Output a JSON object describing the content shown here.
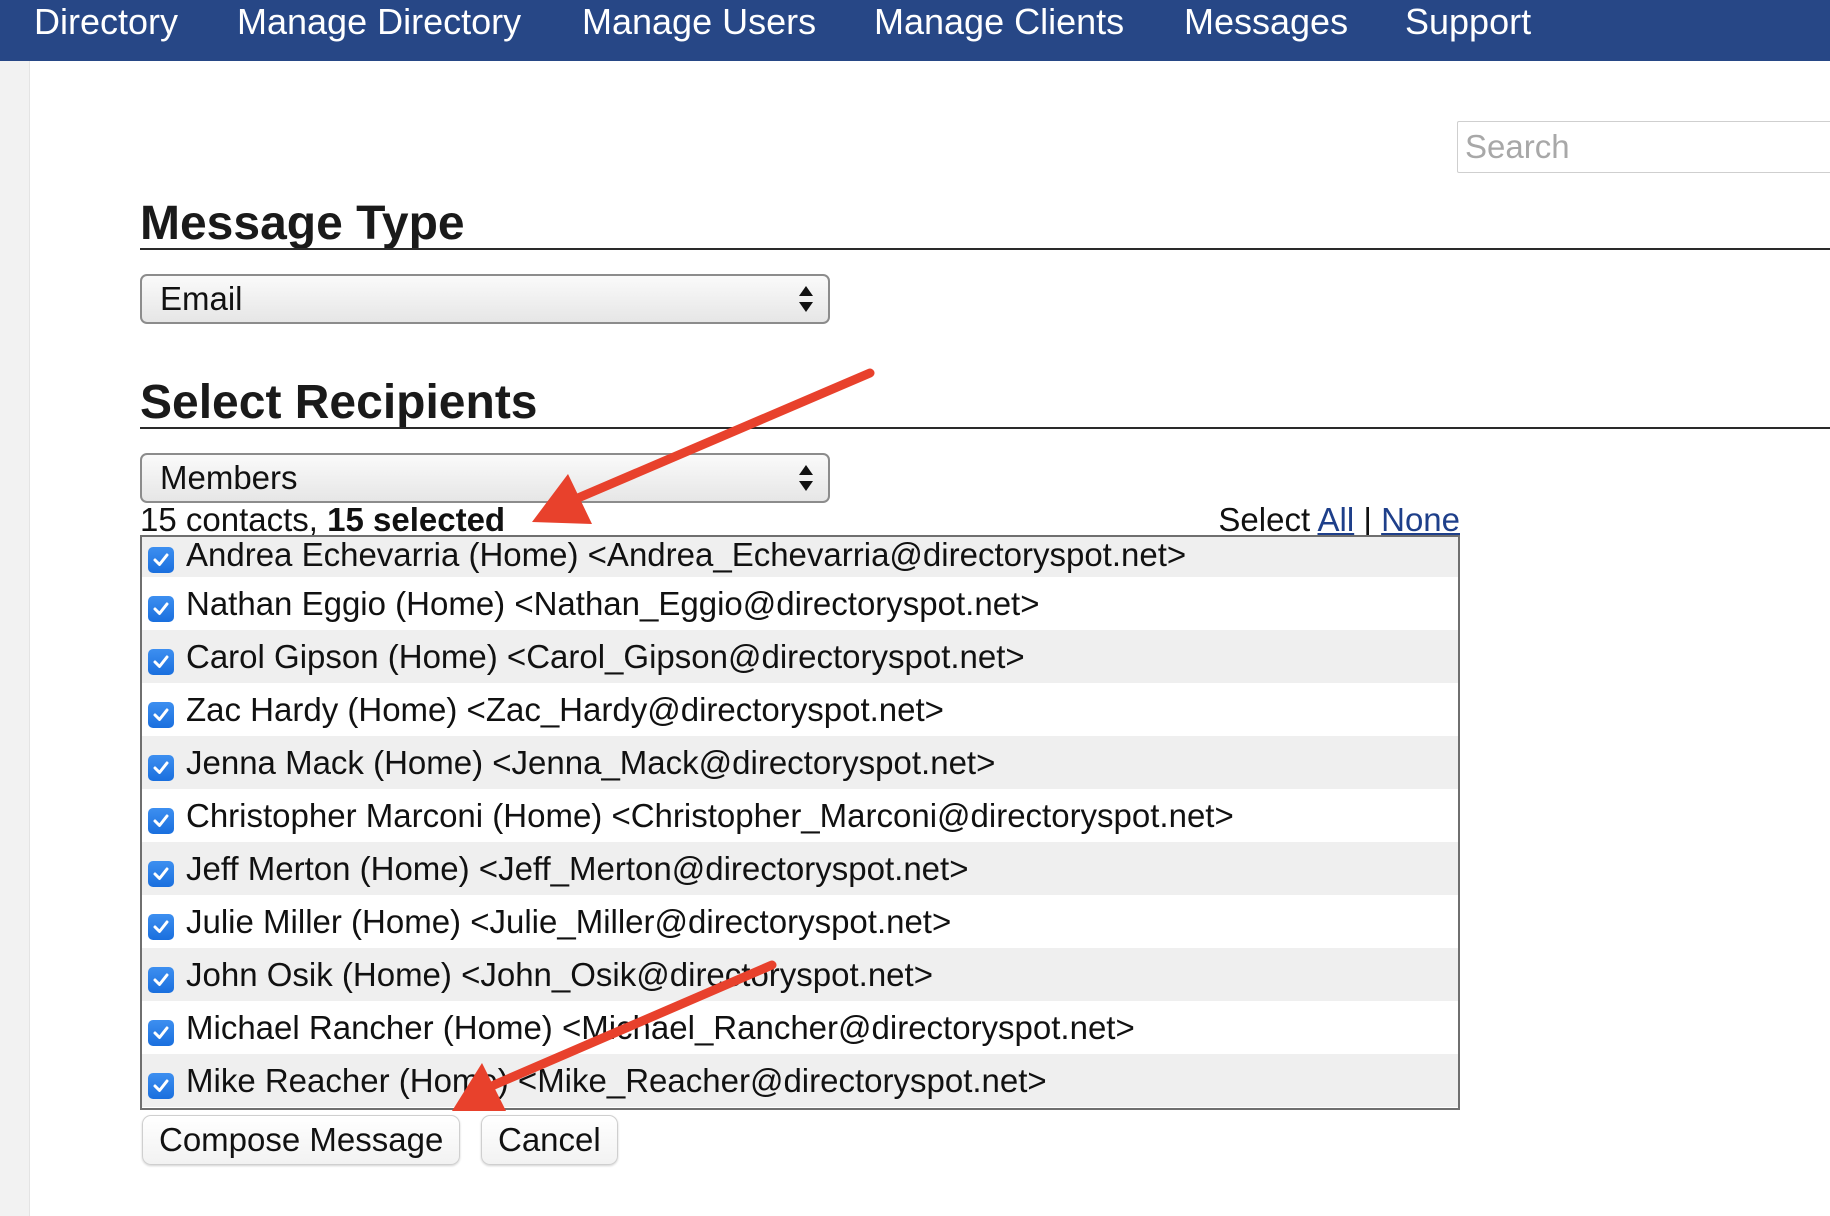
{
  "nav": {
    "items": [
      {
        "label": "Directory"
      },
      {
        "label": "Manage Directory"
      },
      {
        "label": "Manage Users"
      },
      {
        "label": "Manage Clients"
      },
      {
        "label": "Messages"
      },
      {
        "label": "Support"
      }
    ],
    "bg_color": "#274786"
  },
  "search": {
    "placeholder": "Search"
  },
  "message_type": {
    "heading": "Message Type",
    "selected": "Email"
  },
  "recipients": {
    "heading": "Select Recipients",
    "group_selected": "Members",
    "contacts_count_text": "15 contacts,",
    "selected_count_text": "15 selected",
    "select_label": "Select",
    "select_all": "All",
    "separator": "|",
    "select_none": "None",
    "list": [
      {
        "label": "Andrea Echevarria (Home) <Andrea_Echevarria@directoryspot.net>",
        "checked": true
      },
      {
        "label": "Nathan Eggio (Home) <Nathan_Eggio@directoryspot.net>",
        "checked": true
      },
      {
        "label": "Carol Gipson (Home) <Carol_Gipson@directoryspot.net>",
        "checked": true
      },
      {
        "label": "Zac Hardy (Home) <Zac_Hardy@directoryspot.net>",
        "checked": true
      },
      {
        "label": "Jenna Mack (Home) <Jenna_Mack@directoryspot.net>",
        "checked": true
      },
      {
        "label": "Christopher Marconi (Home) <Christopher_Marconi@directoryspot.net>",
        "checked": true
      },
      {
        "label": "Jeff Merton (Home) <Jeff_Merton@directoryspot.net>",
        "checked": true
      },
      {
        "label": "Julie Miller (Home) <Julie_Miller@directoryspot.net>",
        "checked": true
      },
      {
        "label": "John Osik (Home) <John_Osik@directoryspot.net>",
        "checked": true
      },
      {
        "label": "Michael Rancher (Home) <Michael_Rancher@directoryspot.net>",
        "checked": true
      },
      {
        "label": "Mike Reacher (Home) <Mike_Reacher@directoryspot.net>",
        "checked": true
      }
    ]
  },
  "actions": {
    "compose_label": "Compose Message",
    "cancel_label": "Cancel"
  },
  "annotation_color": "#e8412c"
}
